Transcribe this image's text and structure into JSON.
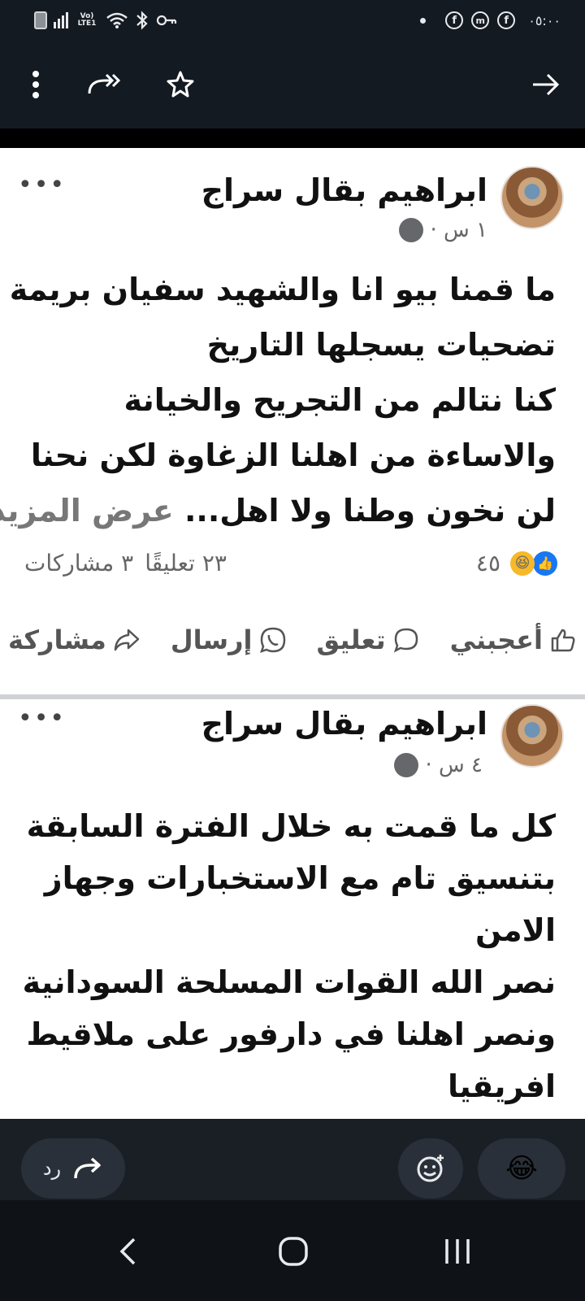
{
  "status_bar": {
    "lte_label": "Vo) LTE1",
    "time": "٠٥:٠٠",
    "icons": [
      "battery-icon",
      "signal-icon",
      "wifi-icon",
      "bluetooth-icon",
      "key-icon",
      "dot-icon",
      "facebook-icon",
      "messenger-icon",
      "facebook-icon"
    ]
  },
  "toolbar": {
    "icons": [
      "more-vertical-icon",
      "share-forward-icon",
      "star-icon",
      "arrow-forward-icon"
    ]
  },
  "posts": [
    {
      "author": "ابراهيم بقال سراج",
      "time": "١ س ·",
      "text_lines": [
        "ما قمنا بيو انا والشهيد سفيان بريمة",
        "تضحيات يسجلها التاريخ",
        "كنا نتالم من التجريح والخيانة",
        "والاساءة من اهلنا الزغاوة لكن نحنا",
        "لن نخون وطنا ولا اهل..."
      ],
      "see_more": "عرض المزيد",
      "reaction_count": "٤٥",
      "comments": "٢٣ تعليقًا",
      "shares": "٣ مشاركات",
      "actions": {
        "like": "أعجبني",
        "comment": "تعليق",
        "send": "إرسال",
        "share": "مشاركة"
      }
    },
    {
      "author": "ابراهيم بقال سراج",
      "time": "٤ س ·",
      "text_lines": [
        "كل ما قمت به خلال الفترة السابقة",
        "بتنسيق تام مع الاستخبارات وجهاز",
        "الامن",
        "نصر الله القوات المسلحة السودانية",
        "ونصر اهلنا في دارفور على ملاقيط",
        "افريقيا"
      ]
    }
  ],
  "reply_bar": {
    "reply_label": "رد",
    "emoji": "😂"
  },
  "colors": {
    "accent": "#1877f2",
    "haha": "#f7b928",
    "dark_bg": "#141a22"
  }
}
